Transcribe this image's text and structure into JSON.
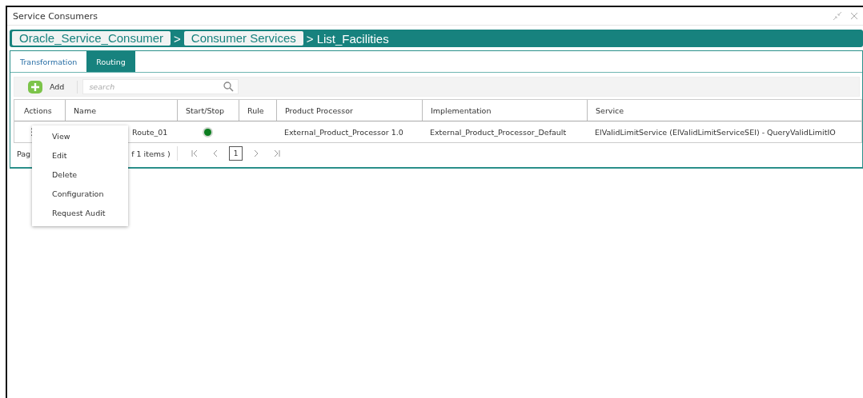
{
  "window": {
    "title": "Service Consumers"
  },
  "breadcrumb": [
    {
      "label": "Oracle_Service_Consumer",
      "kind": "link"
    },
    {
      "label": ">",
      "kind": "sep"
    },
    {
      "label": "Consumer Services",
      "kind": "link"
    },
    {
      "label": "> List_Facilities",
      "kind": "current"
    }
  ],
  "tabs": [
    {
      "label": "Transformation",
      "selected": false
    },
    {
      "label": "Routing",
      "selected": true
    }
  ],
  "toolbar": {
    "add": "Add",
    "search": {
      "placeholder": "search"
    }
  },
  "table": {
    "columns": [
      "Actions",
      "Name",
      "Start/Stop",
      "Rule",
      "Product Processor",
      "Implementation",
      "Service"
    ],
    "rows": [
      {
        "actions": "⋮",
        "name": "Route_01",
        "running": true,
        "rule": "",
        "product_processor": "External_Product_Processor 1.0",
        "implementation": "External_Product_Processor_Default",
        "service": "ElValidLimitService (ElValidLimitServiceSEI) - QueryValidLimitIO"
      }
    ]
  },
  "pager": {
    "label": "Pag",
    "count": "f 1 items )",
    "page": "1"
  },
  "context_menu": [
    "View",
    "Edit",
    "Delete",
    "Configuration",
    "Request Audit"
  ]
}
